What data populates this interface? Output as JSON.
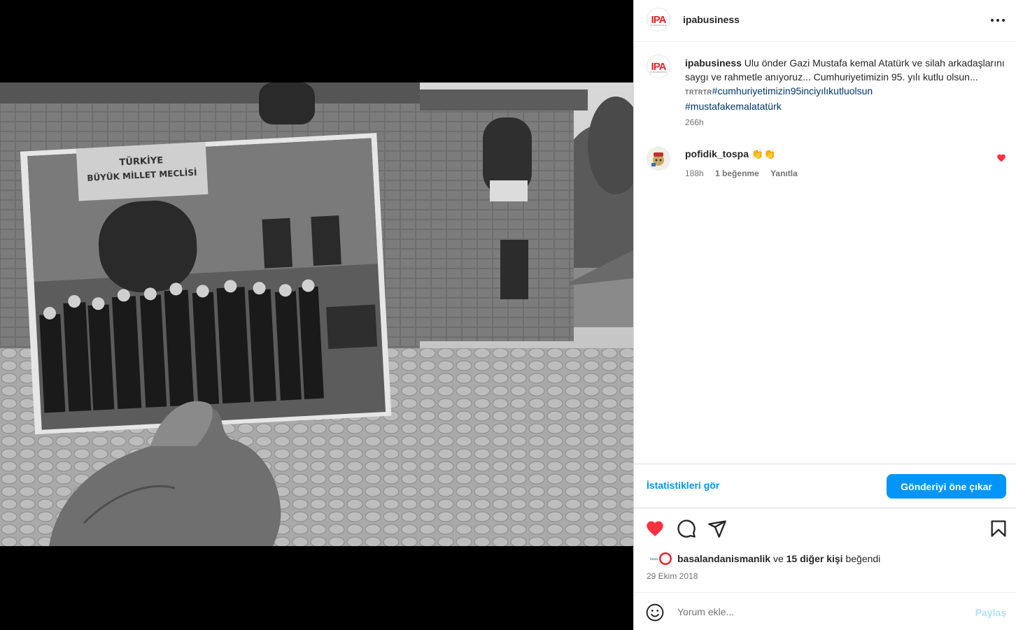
{
  "post": {
    "username": "ipabusiness",
    "avatar_logo": "IPA",
    "avatar_sub": "IP DANIŞMANLIK",
    "more_icon": "more-horizontal-icon",
    "more_label": "•••"
  },
  "caption": {
    "username": "ipabusiness",
    "text": " Ulu önder Gazi Mustafa kemal Atatürk ve silah arkadaşlarını saygı ve rahmetle anıyoruz... Cumhuriyetimizin 95. yılı kutlu olsun... ",
    "flags": "TRTRTR",
    "hashtag_1": "#cumhuriyetimizin95inciyılıkutluolsun",
    "hashtag_2": "#mustafakemalatatürk",
    "time": "266h"
  },
  "comment": {
    "username": "pofidik_tospa",
    "text": " 👏👏",
    "time": "188h",
    "likes": "1 beğenme",
    "reply": "Yanıtla",
    "liked": true,
    "like_color": "#ff3040"
  },
  "insights": {
    "stats_link": "İstatistikleri gör",
    "promote_button": "Gönderiyi öne çıkar"
  },
  "actions": {
    "like_icon": "heart-filled-icon",
    "comment_icon": "comment-icon",
    "share_icon": "send-icon",
    "save_icon": "bookmark-icon",
    "liked": true
  },
  "likes": {
    "first_liker": "basalandanismanlik",
    "joiner": " ve ",
    "others": "15 diğer kişi",
    "suffix": " beğendi"
  },
  "date": "29 Ekim 2018",
  "add_comment": {
    "placeholder": "Yorum ekle...",
    "share_label": "Paylaş"
  },
  "colors": {
    "accent": "#0095f6",
    "like": "#ff3040",
    "link": "#00376b",
    "muted": "#737373"
  }
}
